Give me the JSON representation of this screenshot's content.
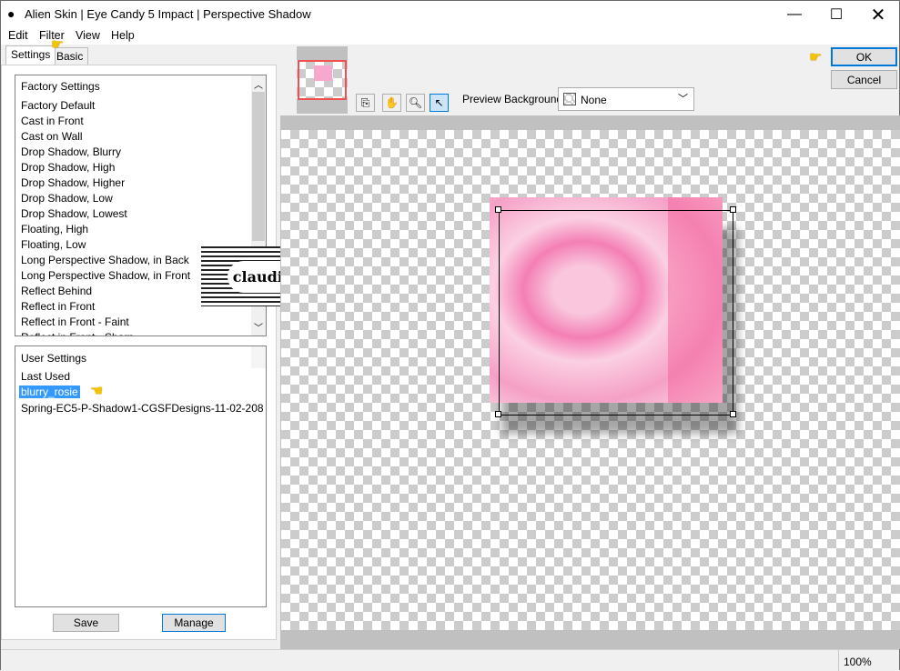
{
  "window": {
    "title": "Alien Skin | Eye Candy 5 Impact | Perspective Shadow",
    "app_icon": "alien-skin-icon"
  },
  "menu": [
    "Edit",
    "Filter",
    "View",
    "Help"
  ],
  "tabs": [
    {
      "label": "Settings",
      "active": true
    },
    {
      "label": "Basic",
      "active": false
    }
  ],
  "factory": {
    "header": "Factory Settings",
    "items": [
      "Factory Default",
      "Cast in Front",
      "Cast on Wall",
      "Drop Shadow, Blurry",
      "Drop Shadow, High",
      "Drop Shadow, Higher",
      "Drop Shadow, Low",
      "Drop Shadow, Lowest",
      "Floating, High",
      "Floating, Low",
      "Long Perspective Shadow, in Back",
      "Long Perspective Shadow, in Front",
      "Reflect Behind",
      "Reflect in Front",
      "Reflect in Front - Faint",
      "Reflect in Front - Sharp"
    ]
  },
  "user": {
    "header": "User Settings",
    "items": [
      "Last Used",
      "blurry_rosie",
      "Spring-EC5-P-Shadow1-CGSFDesigns-11-02-208"
    ],
    "selected": "blurry_rosie"
  },
  "buttons": {
    "save": "Save",
    "manage": "Manage",
    "ok": "OK",
    "cancel": "Cancel"
  },
  "preview": {
    "background_label": "Preview Background:",
    "background_value": "None",
    "zoom": "100%"
  },
  "watermark": "claudia",
  "colors": {
    "selection": "#3399ff",
    "ok_border": "#0078d7",
    "navigator_frame": "#f05050",
    "preview_pink": "#f7a8cc"
  }
}
